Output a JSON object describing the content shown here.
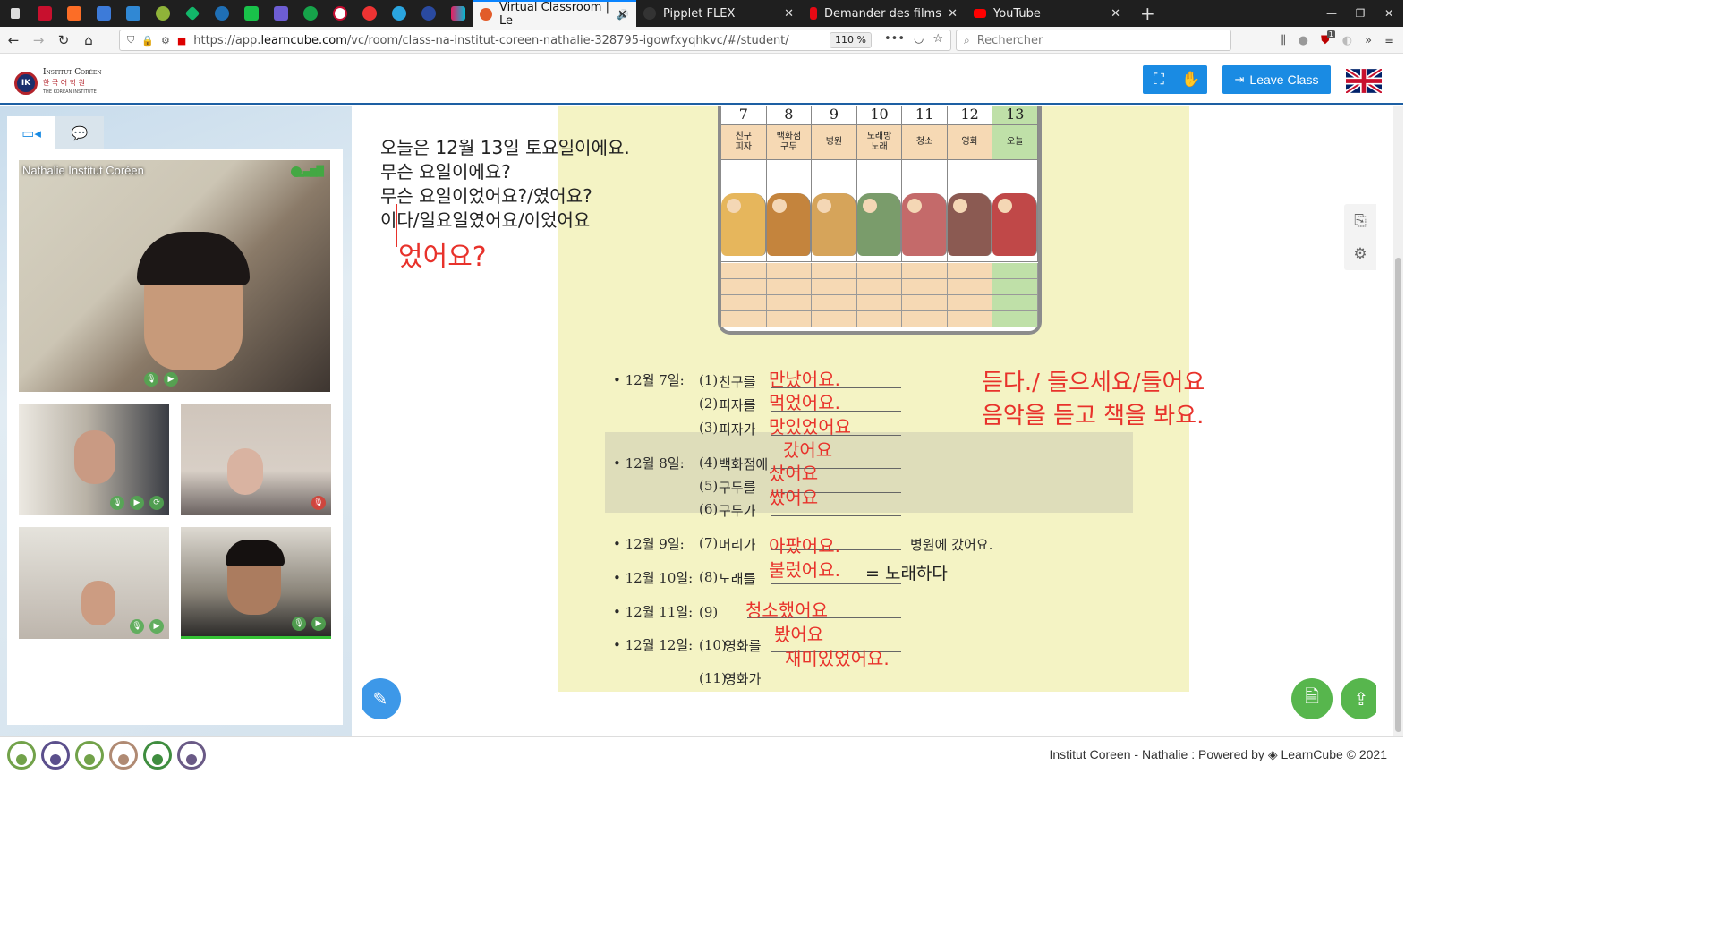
{
  "browser": {
    "tabs": [
      {
        "title": "Virtual Classroom | Le",
        "active": true
      },
      {
        "title": "Pipplet FLEX",
        "active": false
      },
      {
        "title": "Demander des films ou d",
        "active": false
      },
      {
        "title": "YouTube",
        "active": false
      }
    ],
    "url_prefix": "https://app.",
    "url_domain": "learncube.com",
    "url_path": "/vc/room/class-na-institut-coreen-nathalie-328795-igowfxyqhkvc/#/student/",
    "zoom": "110 %",
    "search_placeholder": "Rechercher",
    "addon_badge": "1"
  },
  "header": {
    "logo_line1": "Institut Coréen",
    "logo_line2": "한 국 어 학 원",
    "logo_line3": "THE KOREAN INSTITUTE",
    "leave_label": "Leave Class",
    "language_flag": "uk-flag"
  },
  "sidebar": {
    "videos": [
      {
        "name": "Nathalie Institut Coréen"
      }
    ]
  },
  "whiteboard": {
    "left_notes": [
      "오늘은 12월 13일 토요일이에요.",
      "무슨 요일이에요?",
      "무슨 요일이었어요?/였어요?",
      "이다/일요일였어요/이었어요"
    ],
    "red_left": "었어요?",
    "calendar_days": [
      "7",
      "8",
      "9",
      "10",
      "11",
      "12",
      "13"
    ],
    "calendar_labels": [
      "친구\n피자",
      "백화점\n구두",
      "병원",
      "노래방\n노래",
      "청소",
      "영화",
      "오늘"
    ],
    "exercises": [
      {
        "date": "• 12월 7일:",
        "num": "(1)",
        "word": "친구를",
        "answer": "만났어요."
      },
      {
        "date": "",
        "num": "(2)",
        "word": "피자를",
        "answer": "먹었어요."
      },
      {
        "date": "",
        "num": "(3)",
        "word": "피자가",
        "answer": "맛있었어요"
      },
      {
        "date": "• 12월 8일:",
        "num": "(4)",
        "word": "백화점에",
        "answer": "갔어요"
      },
      {
        "date": "",
        "num": "(5)",
        "word": "구두를",
        "answer": "샀어요"
      },
      {
        "date": "",
        "num": "(6)",
        "word": "구두가",
        "answer": "쌌어요"
      },
      {
        "date": "• 12월 9일:",
        "num": "(7)",
        "word": "머리가",
        "answer": "아팠어요."
      },
      {
        "date": "• 12월 10일:",
        "num": "(8)",
        "word": "노래를",
        "answer": "불렀어요."
      },
      {
        "date": "• 12월 11일:",
        "num": "(9)",
        "word": "",
        "answer": "청소했어요"
      },
      {
        "date": "• 12월 12일:",
        "num": "(10)",
        "word": "영화를",
        "answer": "봤어요"
      },
      {
        "date": "",
        "num": "(11)",
        "word": "영화가",
        "answer": "재미있었어요."
      }
    ],
    "extra_hospital": "병원에 갔어요.",
    "extra_note": "= 노래하다",
    "red_right_1": "듣다./ 들으세요/들어요",
    "red_right_2": "음악을 듣고 책을 봐요."
  },
  "footer": {
    "room_label": "Institut Coreen - Nathalie :",
    "powered_label": "Powered by",
    "brand_label": "LearnCube © 2021"
  },
  "colors": {
    "accent": "#1a8be3",
    "annotation_red": "#e8322b",
    "green": "#43a843"
  }
}
